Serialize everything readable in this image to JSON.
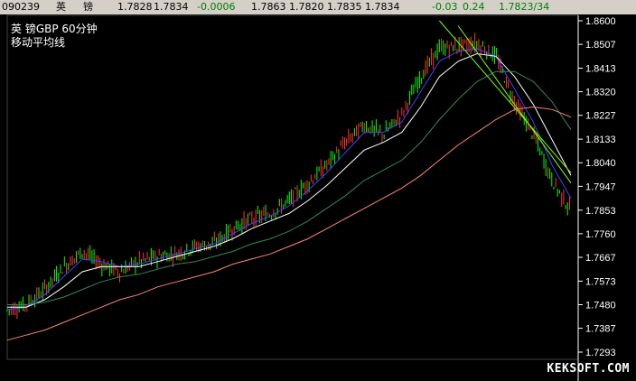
{
  "quote_bar": {
    "code": "090239",
    "name_1": "英",
    "name_2": "镑",
    "values": [
      "1.7828",
      "1.7834"
    ],
    "change": "-0.0006",
    "values2": [
      "1.7863",
      "1.7820",
      "1.7835",
      "1.7834"
    ],
    "change2": "-0.03",
    "pct": "0.24",
    "last": "1.7823/34",
    "colors": {
      "bg": "#d4d0c8",
      "text": "#000000",
      "change": "#008000"
    }
  },
  "chart_data": {
    "type": "line",
    "title": "英    镑GBP   60分钟",
    "subtitle": "移动平均线",
    "watermark": "KEKSOFT.COM",
    "y_ticks": [
      "1.8600",
      "1.8507",
      "1.8413",
      "1.8320",
      "1.8227",
      "1.8133",
      "1.8040",
      "1.7947",
      "1.7853",
      "1.7760",
      "1.7667",
      "1.7573",
      "1.7480",
      "1.7387",
      "1.7293"
    ],
    "ylim": [
      1.7293,
      1.86
    ],
    "x": [
      0,
      20,
      40,
      60,
      80,
      100,
      120,
      140,
      160,
      180,
      200,
      220,
      240,
      260,
      280,
      300,
      320,
      340,
      360,
      380,
      400,
      420,
      440,
      460,
      480,
      500,
      520,
      540,
      560,
      580,
      600
    ],
    "price": [
      1.746,
      1.748,
      1.754,
      1.763,
      1.769,
      1.764,
      1.761,
      1.765,
      1.767,
      1.768,
      1.771,
      1.772,
      1.778,
      1.782,
      1.784,
      1.789,
      1.796,
      1.803,
      1.812,
      1.819,
      1.815,
      1.823,
      1.838,
      1.849,
      1.85,
      1.851,
      1.846,
      1.828,
      1.815,
      1.797,
      1.785
    ],
    "series": [
      {
        "color": "#4040ff",
        "values": [
          1.746,
          1.747,
          1.752,
          1.759,
          1.766,
          1.765,
          1.763,
          1.764,
          1.766,
          1.768,
          1.77,
          1.772,
          1.776,
          1.78,
          1.783,
          1.787,
          1.793,
          1.8,
          1.808,
          1.816,
          1.816,
          1.82,
          1.832,
          1.844,
          1.848,
          1.849,
          1.846,
          1.833,
          1.82,
          1.803,
          1.79
        ]
      },
      {
        "color": "#ffffff",
        "values": [
          1.747,
          1.747,
          1.75,
          1.755,
          1.761,
          1.763,
          1.763,
          1.763,
          1.765,
          1.767,
          1.769,
          1.771,
          1.774,
          1.778,
          1.781,
          1.784,
          1.789,
          1.795,
          1.802,
          1.809,
          1.812,
          1.816,
          1.826,
          1.838,
          1.844,
          1.847,
          1.846,
          1.838,
          1.827,
          1.813,
          1.799
        ]
      },
      {
        "color": "#2e8b57",
        "values": [
          1.748,
          1.748,
          1.749,
          1.751,
          1.754,
          1.757,
          1.759,
          1.76,
          1.762,
          1.764,
          1.765,
          1.767,
          1.769,
          1.772,
          1.774,
          1.777,
          1.781,
          1.786,
          1.791,
          1.797,
          1.801,
          1.805,
          1.812,
          1.821,
          1.829,
          1.836,
          1.84,
          1.84,
          1.836,
          1.828,
          1.817
        ]
      },
      {
        "color": "#ff8080",
        "values": [
          1.734,
          1.736,
          1.738,
          1.741,
          1.744,
          1.747,
          1.75,
          1.752,
          1.755,
          1.757,
          1.759,
          1.761,
          1.764,
          1.766,
          1.768,
          1.771,
          1.774,
          1.778,
          1.782,
          1.786,
          1.79,
          1.794,
          1.799,
          1.805,
          1.811,
          1.816,
          1.821,
          1.825,
          1.826,
          1.825,
          1.822
        ]
      }
    ],
    "trendlines": [
      {
        "color": "#7fff00",
        "x": [
          460,
          600
        ],
        "values": [
          1.86,
          1.8
        ]
      },
      {
        "color": "#7fff00",
        "x": [
          480,
          600
        ],
        "values": [
          1.858,
          1.796
        ]
      }
    ],
    "colors": {
      "background": "#000000",
      "axis": "#ffffff",
      "grid": "#404040",
      "bull": "#00ff00",
      "bear": "#ff3333"
    }
  }
}
